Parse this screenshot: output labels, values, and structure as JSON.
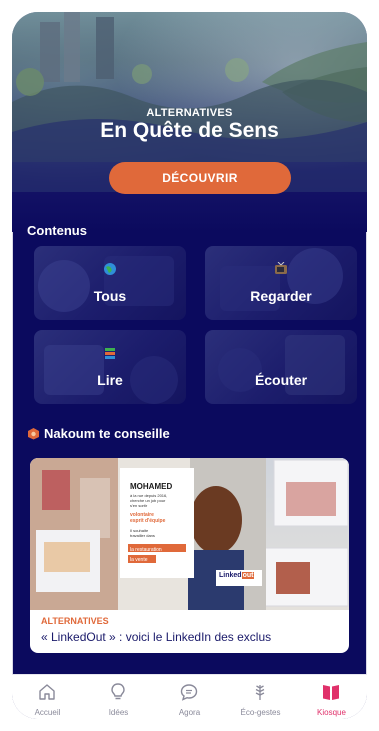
{
  "hero": {
    "kicker": "ALTERNATIVES",
    "title": "En Quête de Sens",
    "cta_label": "DÉCOUVRIR"
  },
  "contents": {
    "title": "Contenus",
    "tiles": [
      {
        "label": "Tous",
        "icon": "globe-icon"
      },
      {
        "label": "Regarder",
        "icon": "tv-icon"
      },
      {
        "label": "Lire",
        "icon": "books-icon"
      },
      {
        "label": "Écouter",
        "icon": "headphones-icon"
      }
    ]
  },
  "advice": {
    "title": "Nakoum te conseille",
    "icon": "nakoum-icon"
  },
  "article": {
    "kicker": "ALTERNATIVES",
    "title": "« LinkedOut » : voici le LinkedIn des exclus",
    "poster": {
      "name": "MOHAMED",
      "lines": [
        "à la rue depuis 2016,",
        "cherche un job pour",
        "s'en sortir"
      ],
      "highlight": [
        "volontaire",
        "esprit d'équipe"
      ],
      "wish": [
        "Il souhaite",
        "travailler dans"
      ],
      "sectors": [
        "la restauration",
        "la vente"
      ],
      "brand_left": "Linked",
      "brand_right": "out"
    }
  },
  "nav": {
    "items": [
      {
        "label": "Accueil",
        "icon": "home-icon",
        "active": false
      },
      {
        "label": "Idées",
        "icon": "lightbulb-icon",
        "active": false
      },
      {
        "label": "Agora",
        "icon": "chat-bubble-icon",
        "active": false
      },
      {
        "label": "Éco-gestes",
        "icon": "wheat-icon",
        "active": false
      },
      {
        "label": "Kiosque",
        "icon": "book-open-icon",
        "active": true
      }
    ]
  },
  "colors": {
    "background": "#0b0a5e",
    "accent": "#e0693a",
    "active_nav": "#e0306a"
  }
}
